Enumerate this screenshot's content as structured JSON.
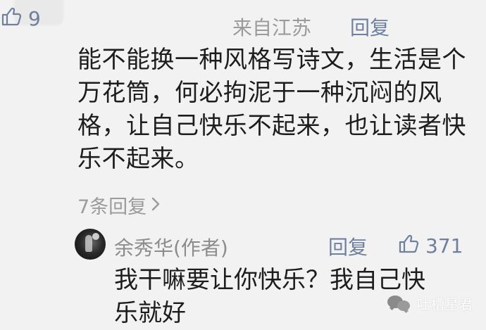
{
  "comment": {
    "location": "来自江苏",
    "reply_label": "回复",
    "like_count": "9",
    "text": "能不能换一种风格写诗文，生活是个万花筒，何必拘泥于一种沉闷的风格，让自己快乐不起来，也让读者快乐不起来。",
    "replies_link": "7条回复"
  },
  "reply": {
    "author": "余秀华(作者)",
    "reply_label": "回复",
    "like_count": "371",
    "text": "我干嘛要让你快乐？我自己快乐就好"
  },
  "watermark": {
    "text": "吐槽星君"
  },
  "icons": {
    "like": "thumbs-up-icon",
    "chevron": "chevron-right-icon",
    "watermark": "wechat-bubbles-icon"
  },
  "colors": {
    "background": "#f2f2f2",
    "text_primary": "#1d1d1d",
    "text_secondary": "#9b9b9b",
    "action": "#6f7f9e"
  }
}
